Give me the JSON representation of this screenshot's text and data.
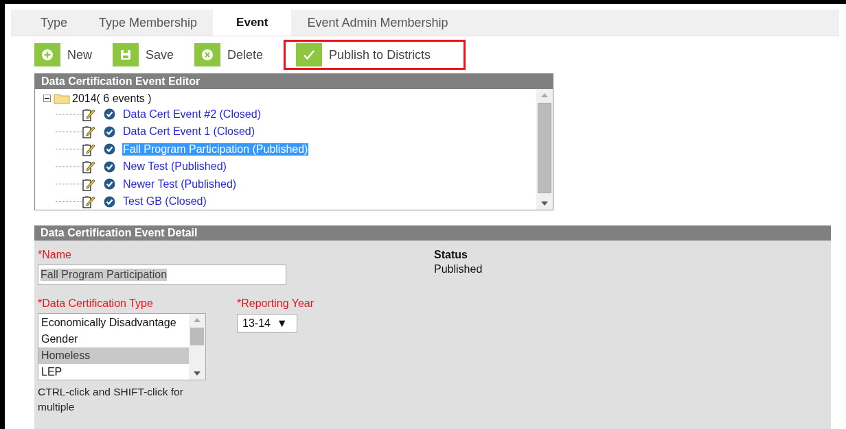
{
  "tabs": [
    {
      "label": "Type",
      "selected": false
    },
    {
      "label": "Type Membership",
      "selected": false
    },
    {
      "label": "Event",
      "selected": true
    },
    {
      "label": "Event Admin Membership",
      "selected": false
    }
  ],
  "toolbar": [
    {
      "label": "New",
      "kind": "new",
      "highlighted": false
    },
    {
      "label": "Save",
      "kind": "save",
      "highlighted": false
    },
    {
      "label": "Delete",
      "kind": "delete",
      "highlighted": false
    },
    {
      "label": "Publish to Districts",
      "kind": "publish",
      "highlighted": true
    }
  ],
  "editor": {
    "title": "Data Certification Event Editor",
    "tree": [
      {
        "label": "2014( 6 events )",
        "expanded": true,
        "children": [
          {
            "label": "Data Cert Event #2 (Closed)",
            "selected": false
          },
          {
            "label": "Data Cert Event 1 (Closed)",
            "selected": false
          },
          {
            "label": "Fall Program Participation (Published)",
            "selected": true
          },
          {
            "label": "New Test (Published)",
            "selected": false
          },
          {
            "label": "Newer Test (Published)",
            "selected": false
          },
          {
            "label": "Test GB (Closed)",
            "selected": false
          }
        ]
      }
    ]
  },
  "detail": {
    "title": "Data Certification Event Detail",
    "name": {
      "label": "*Name",
      "value": "Fall Program Participation"
    },
    "status": {
      "label": "Status",
      "value": "Published"
    },
    "type": {
      "label": "*Data Certification Type",
      "options": [
        {
          "label": "Economically Disadvantage",
          "selected": false
        },
        {
          "label": "Gender",
          "selected": false
        },
        {
          "label": "Homeless",
          "selected": true
        },
        {
          "label": "LEP",
          "selected": false
        }
      ],
      "hint": "CTRL-click and SHIFT-click for multiple"
    },
    "year": {
      "label": "*Reporting Year",
      "value": "13-14",
      "caret": "▼"
    }
  }
}
